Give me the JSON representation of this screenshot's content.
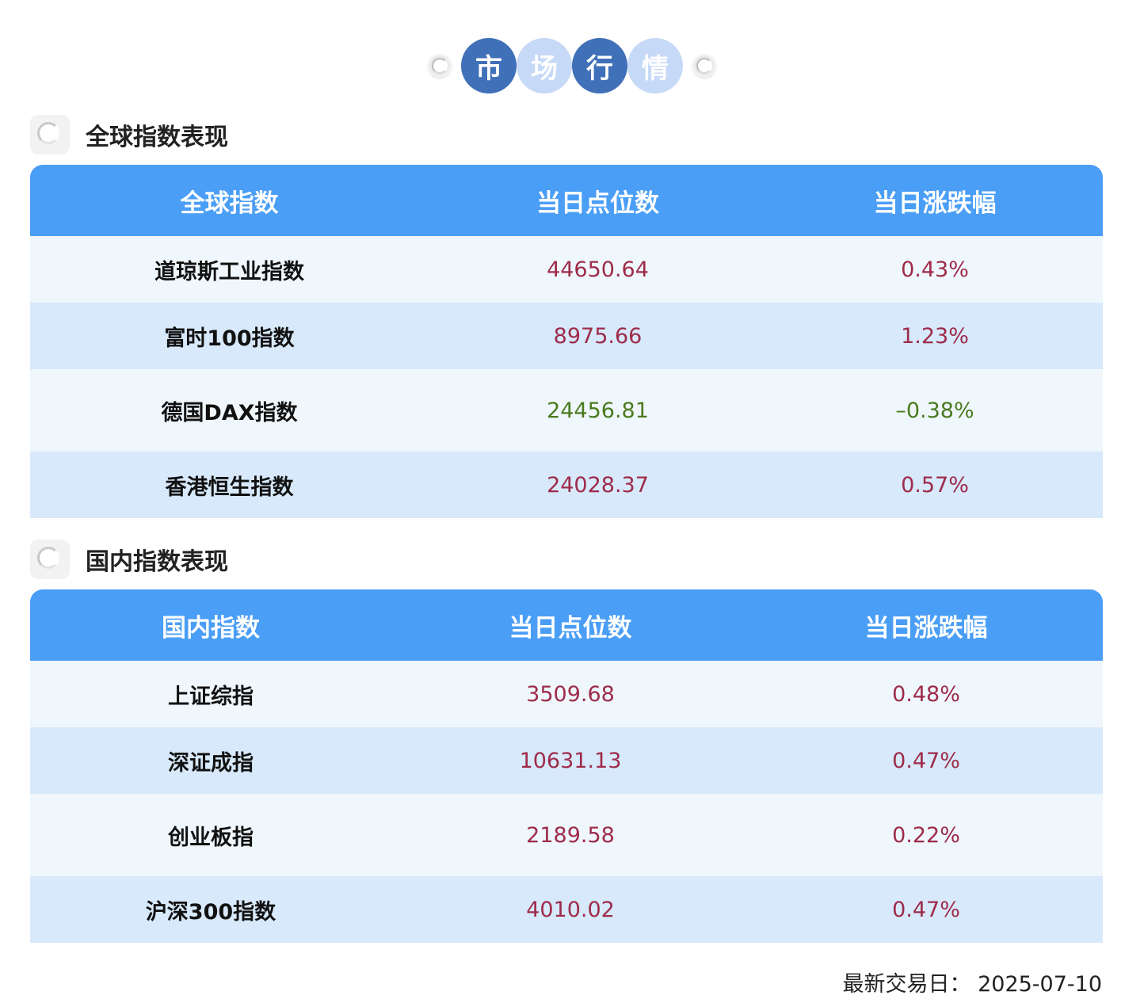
{
  "title_chars": [
    "市",
    "场",
    "行",
    "情"
  ],
  "global": {
    "section_title": "全球指数表现",
    "headers": [
      "全球指数",
      "当日点位数",
      "当日涨跌幅"
    ],
    "rows": [
      {
        "name": "道琼斯工业指数",
        "value": "44650.64",
        "change": "0.43%"
      },
      {
        "name": "富时100指数",
        "value": "8975.66",
        "change": "1.23%"
      },
      {
        "name": "德国DAX指数",
        "value": "24456.81",
        "change": "–0.38%"
      },
      {
        "name": "香港恒生指数",
        "value": "24028.37",
        "change": "0.57%"
      }
    ]
  },
  "domestic": {
    "section_title": "国内指数表现",
    "headers": [
      "国内指数",
      "当日点位数",
      "当日涨跌幅"
    ],
    "rows": [
      {
        "name": "上证综指",
        "value": "3509.68",
        "change": "0.48%"
      },
      {
        "name": "深证成指",
        "value": "10631.13",
        "change": "0.47%"
      },
      {
        "name": "创业板指",
        "value": "2189.58",
        "change": "0.22%"
      },
      {
        "name": "沪深300指数",
        "value": "4010.02",
        "change": "0.47%"
      }
    ]
  },
  "footer": {
    "latest_trading_day": "最新交易日：  2025-07-10"
  },
  "colors": {
    "header_bg": "#4a9ef6",
    "row_light": "#eff7fc",
    "row_dark": "#d7e9fa",
    "rise_text": "#9e2b4a",
    "fall_text": "#4b7a1e",
    "title_dark": "#3f70b8",
    "title_light": "#c6d9f7"
  }
}
